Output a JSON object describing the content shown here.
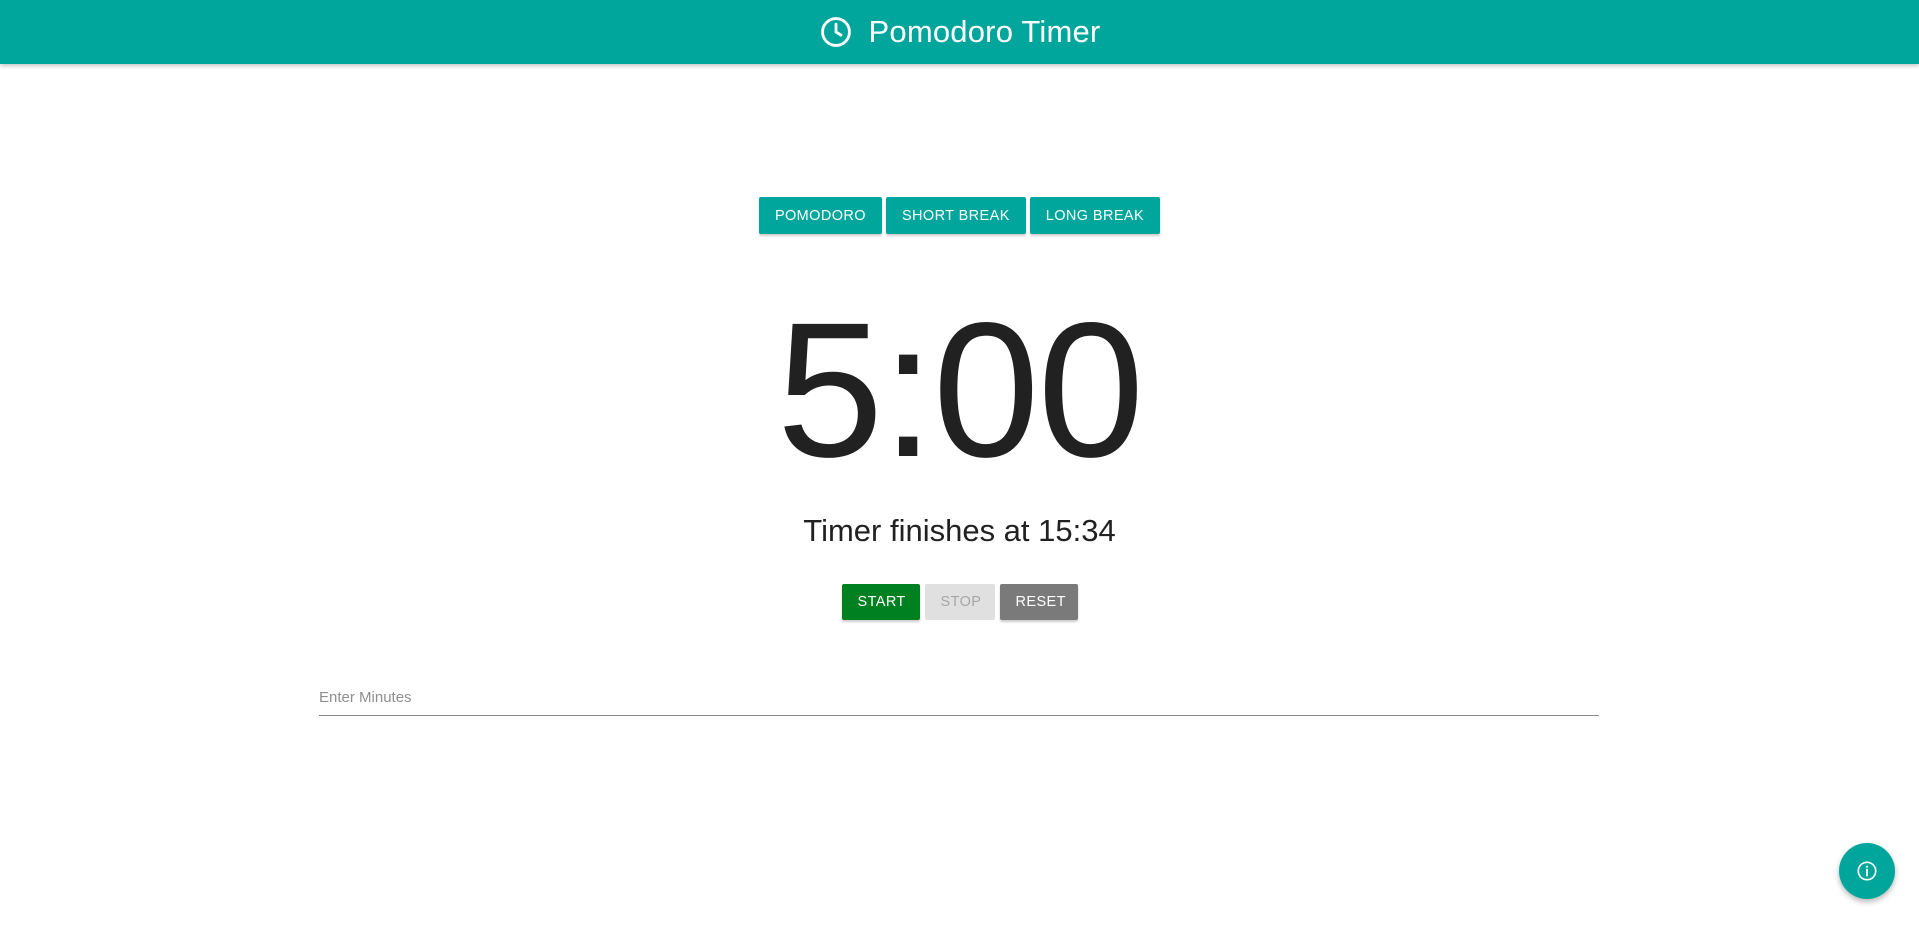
{
  "appbar": {
    "title": "Pomodoro Timer",
    "icon": "clock-icon",
    "color": "#00a69c"
  },
  "modes": [
    {
      "label": "POMODORO"
    },
    {
      "label": "SHORT BREAK"
    },
    {
      "label": "LONG BREAK"
    }
  ],
  "timer": {
    "display": "5:00",
    "finish_text": "Timer finishes at 15:34"
  },
  "controls": {
    "start_label": "START",
    "stop_label": "STOP",
    "reset_label": "RESET",
    "stop_disabled": true,
    "start_color": "#008021",
    "reset_color": "#7a7a7a"
  },
  "minutes_input": {
    "value": "",
    "placeholder": "Enter Minutes"
  },
  "fab": {
    "icon": "info-icon"
  }
}
